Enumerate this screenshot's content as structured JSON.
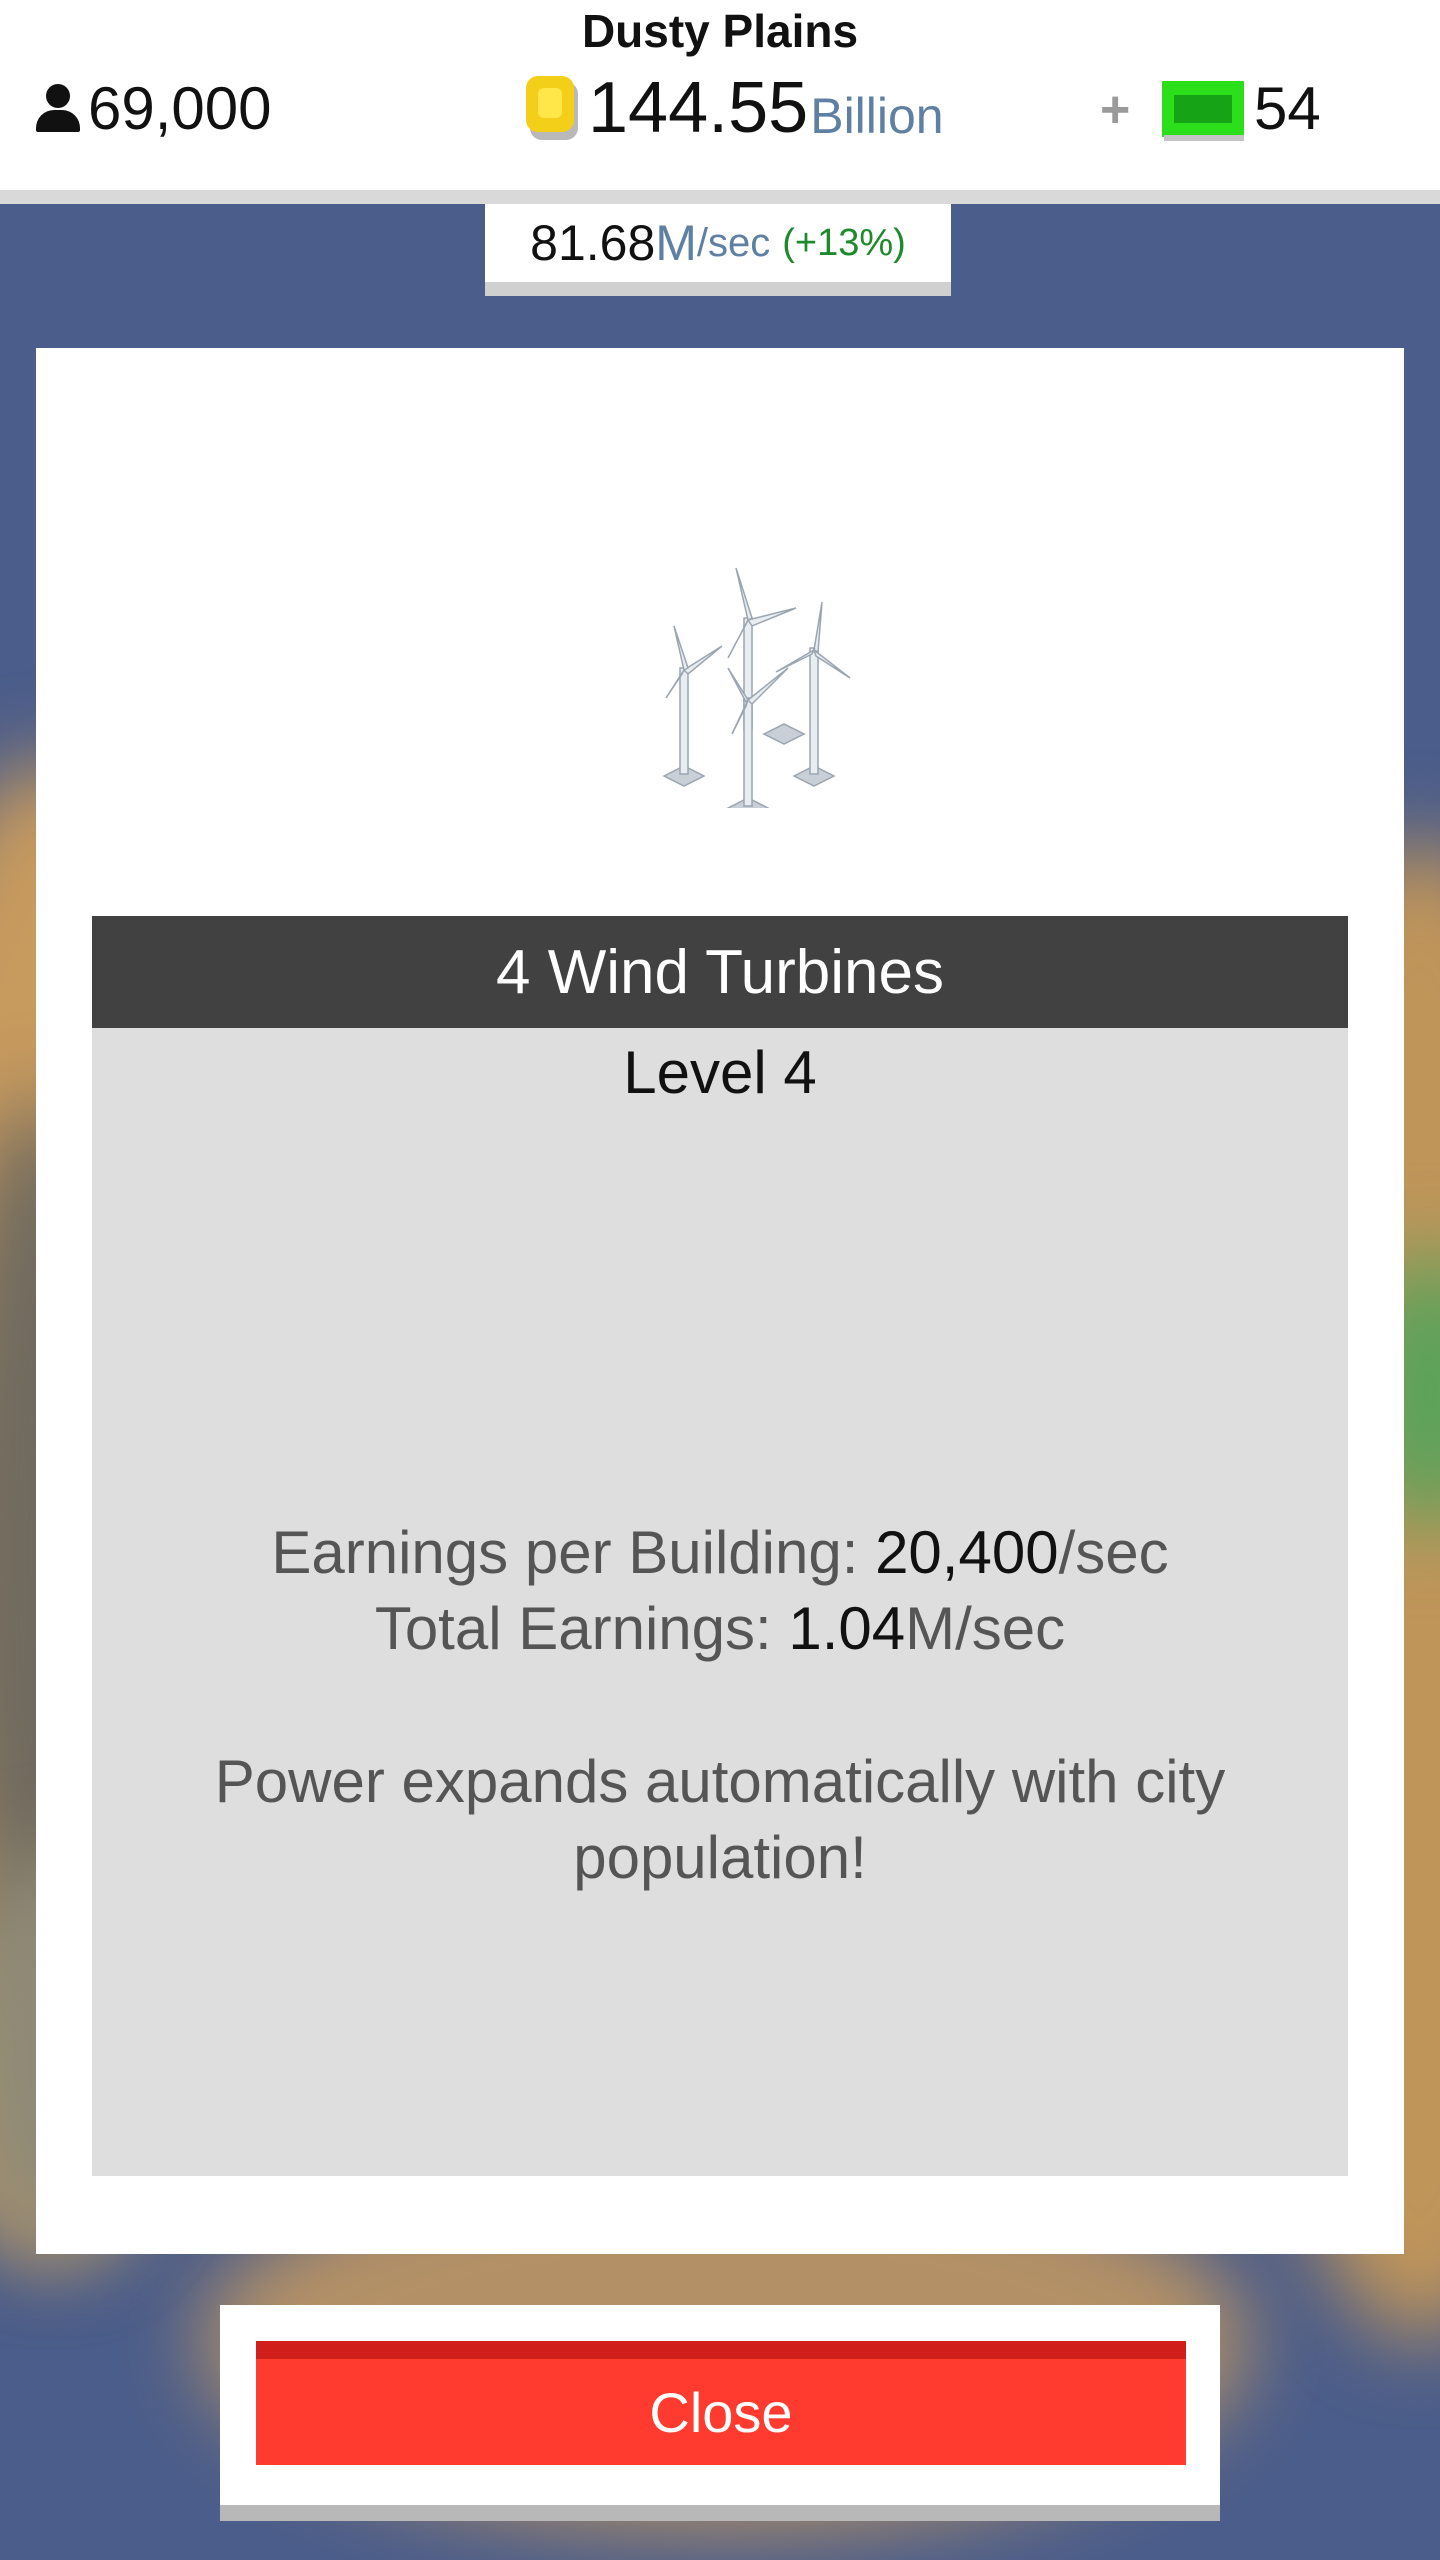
{
  "header": {
    "city_name": "Dusty Plains",
    "population": "69,000",
    "money_value": "144.55",
    "money_unit": "Billion",
    "plus_label": "+",
    "cash_value": "54",
    "rate_value": "81.68",
    "rate_unit_m": "M",
    "rate_unit_sec": "/sec",
    "rate_bonus": "(+13%)"
  },
  "icons": {
    "population": "person-icon",
    "money": "coin-icon",
    "cash": "cash-icon",
    "building": "wind-turbines-icon"
  },
  "modal": {
    "title": "4 Wind Turbines",
    "level": "Level 4",
    "earn_per_building_label": "Earnings per Building: ",
    "earn_per_building_value": "20,400",
    "earn_per_building_unit": "/sec",
    "total_label": "Total Earnings: ",
    "total_value": "1.04",
    "total_unit": "M/sec",
    "description": "Power expands automatically with city population!",
    "close_label": "Close"
  },
  "colors": {
    "backdrop": "#4b5d8a",
    "title_bar": "#414141",
    "panel": "#dedede",
    "close_button": "#ff3a2e",
    "bonus": "#1f8a2d",
    "unit_blue": "#5f7fa3"
  }
}
